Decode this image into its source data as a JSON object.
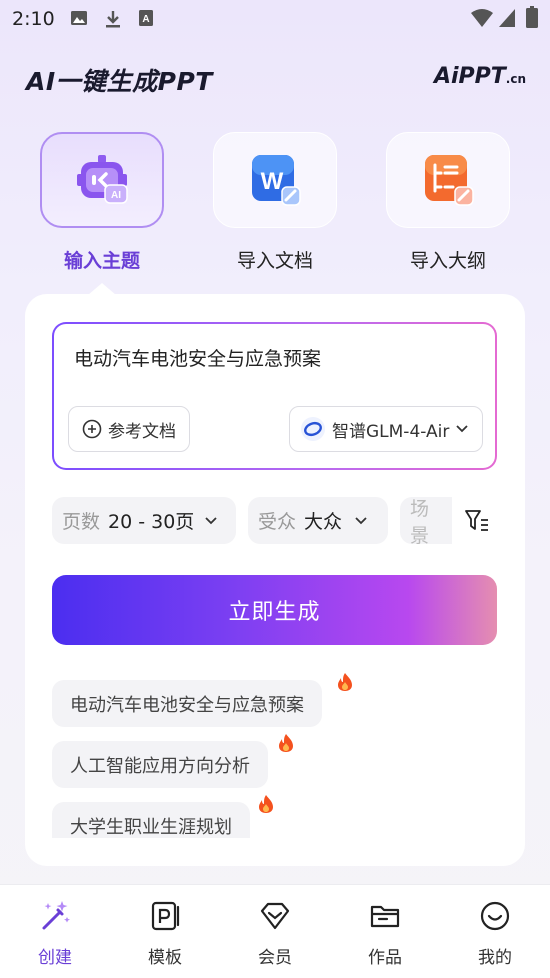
{
  "status_bar": {
    "time": "2:10"
  },
  "header": {
    "app_title": "AI一键生成PPT",
    "brand_main": "AiPPT",
    "brand_suffix": ".cn"
  },
  "modes": [
    {
      "label": "输入主题",
      "active": true
    },
    {
      "label": "导入文档",
      "active": false
    },
    {
      "label": "导入大纲",
      "active": false
    }
  ],
  "topic": {
    "value": "电动汽车电池安全与应急预案",
    "reference_button": "参考文档",
    "model": "智谱GLM-4-Air"
  },
  "options": {
    "pages_key": "页数",
    "pages_value": "20 - 30页",
    "audience_key": "受众",
    "audience_value": "大众",
    "scene_key": "场景"
  },
  "generate_button": "立即生成",
  "suggestions": [
    "电动汽车电池安全与应急预案",
    "人工智能应用方向分析",
    "大学生职业生涯规划"
  ],
  "bottom_nav": [
    {
      "label": "创建",
      "icon": "magic-wand-icon",
      "active": true
    },
    {
      "label": "模板",
      "icon": "ppt-template-icon",
      "active": false
    },
    {
      "label": "会员",
      "icon": "diamond-icon",
      "active": false
    },
    {
      "label": "作品",
      "icon": "folder-icon",
      "active": false
    },
    {
      "label": "我的",
      "icon": "smile-face-icon",
      "active": false
    }
  ],
  "colors": {
    "accent": "#6a3fd6",
    "gradient_start": "#4b2ef0",
    "gradient_end": "#e58eb0"
  }
}
